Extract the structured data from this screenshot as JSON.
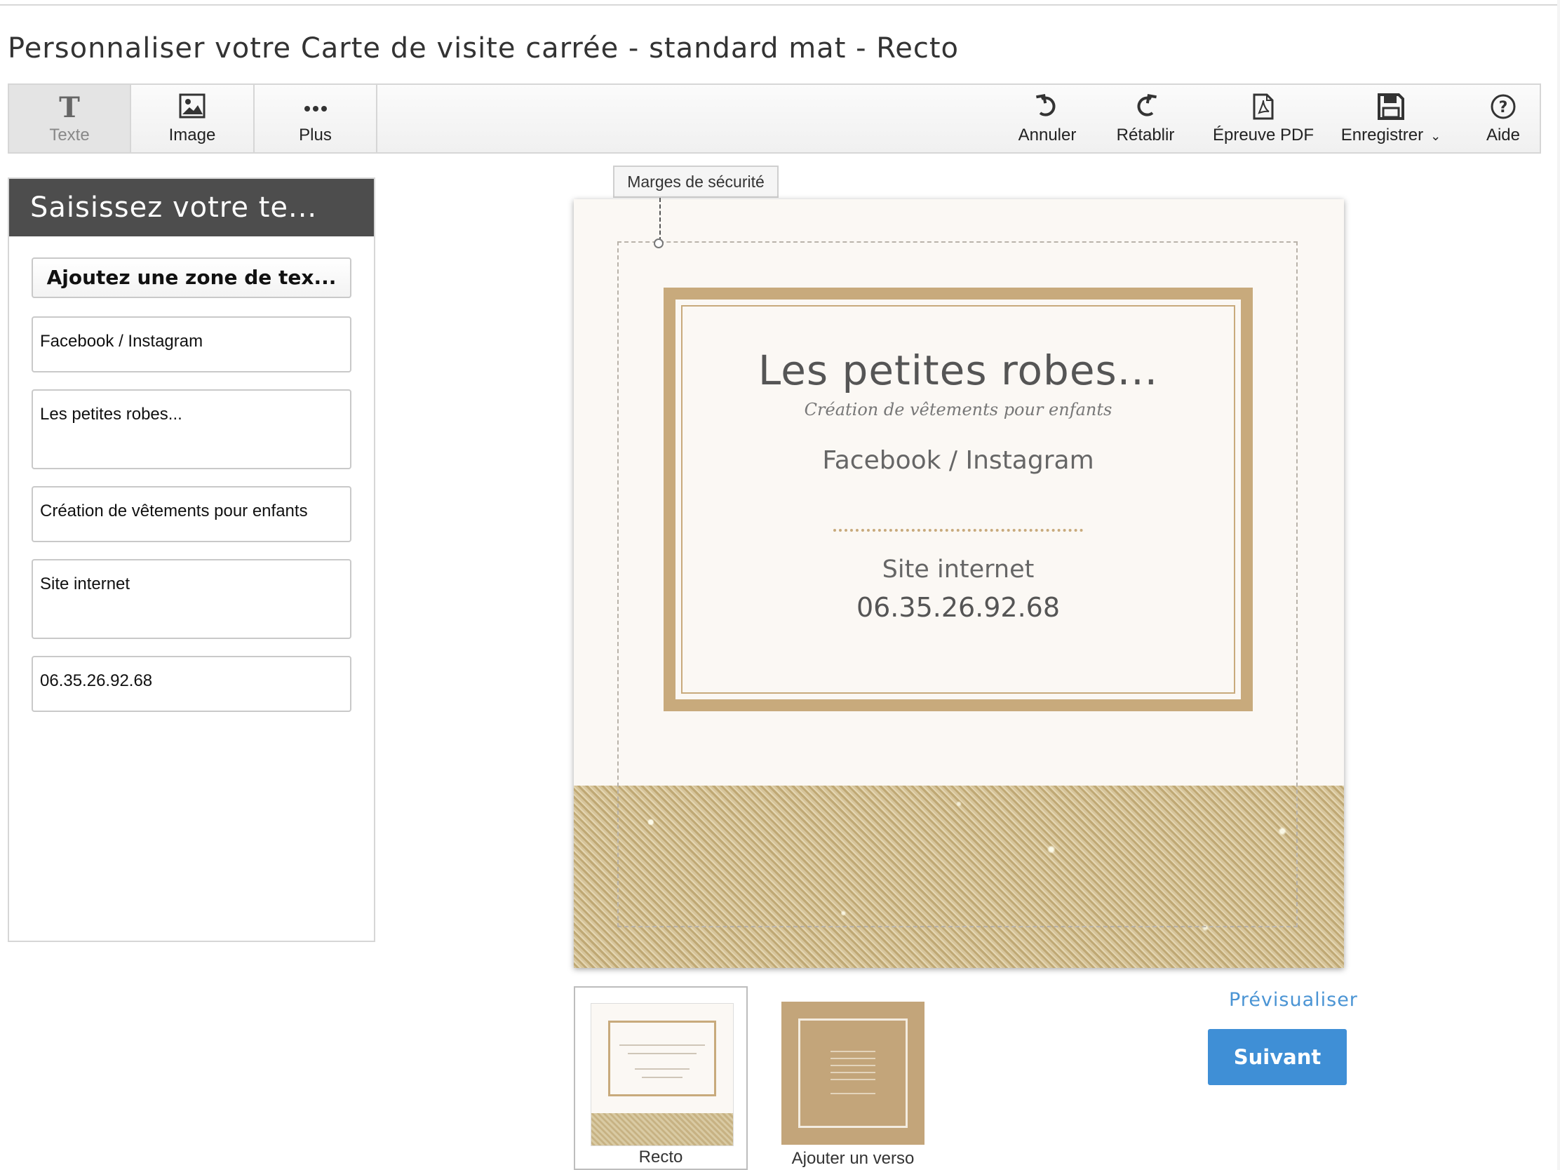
{
  "page": {
    "title": "Personnaliser votre Carte de visite carrée - standard mat - Recto"
  },
  "toolbar": {
    "left": [
      {
        "label": "Texte",
        "icon": "text-icon",
        "active": true
      },
      {
        "label": "Image",
        "icon": "image-icon",
        "active": false
      },
      {
        "label": "Plus",
        "icon": "more-icon",
        "active": false
      }
    ],
    "right": [
      {
        "label": "Annuler",
        "icon": "undo-icon"
      },
      {
        "label": "Rétablir",
        "icon": "redo-icon"
      },
      {
        "label": "Épreuve PDF",
        "icon": "pdf-icon"
      },
      {
        "label": "Enregistrer",
        "icon": "save-icon",
        "has_dropdown": true
      },
      {
        "label": "Aide",
        "icon": "help-icon"
      }
    ]
  },
  "panel": {
    "header": "Saisissez votre te...",
    "add_button": "Ajoutez une zone de tex...",
    "fields": [
      "Facebook / Instagram",
      "Les petites robes...",
      "Création de vêtements pour enfants",
      "Site internet",
      "06.35.26.92.68"
    ]
  },
  "canvas": {
    "margin_label": "Marges de sécurité",
    "card": {
      "title": "Les petites robes...",
      "subtitle": "Création de vêtements pour enfants",
      "social": "Facebook / Instagram",
      "website": "Site internet",
      "phone": "06.35.26.92.68",
      "frame_color": "#c8aa7c",
      "background_color": "#fbf8f4"
    }
  },
  "thumbnails": [
    {
      "label": "Recto",
      "selected": true
    },
    {
      "label": "Ajouter un verso",
      "selected": false
    }
  ],
  "actions": {
    "preview": "Prévisualiser",
    "next": "Suivant",
    "accent_color": "#3f8fd6"
  }
}
